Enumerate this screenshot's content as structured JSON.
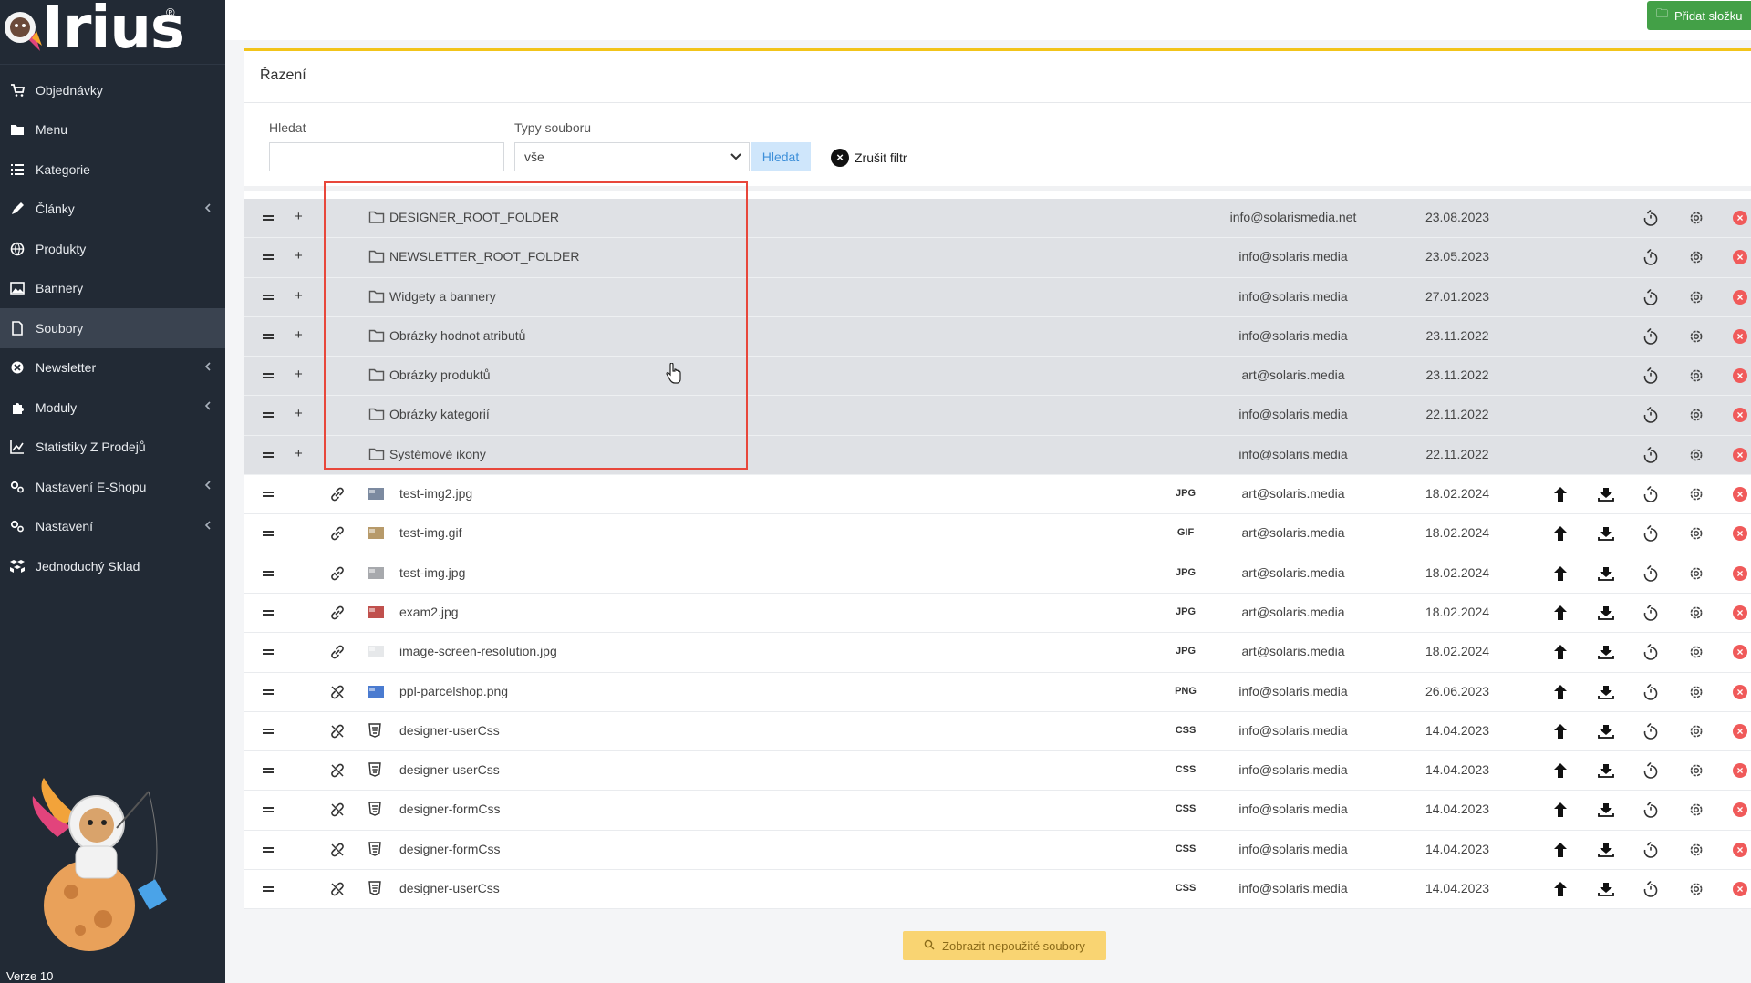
{
  "app": {
    "logo_text": "Irius",
    "logo_mark": "®",
    "version": "Verze 10"
  },
  "sidebar": {
    "items": [
      {
        "label": "Objednávky",
        "icon": "cart-icon",
        "chevron": false,
        "active": false
      },
      {
        "label": "Menu",
        "icon": "folder-icon",
        "chevron": false,
        "active": false
      },
      {
        "label": "Kategorie",
        "icon": "list-icon",
        "chevron": false,
        "active": false
      },
      {
        "label": "Články",
        "icon": "pen-icon",
        "chevron": true,
        "active": false
      },
      {
        "label": "Produkty",
        "icon": "globe-icon",
        "chevron": false,
        "active": false
      },
      {
        "label": "Bannery",
        "icon": "image-icon",
        "chevron": false,
        "active": false
      },
      {
        "label": "Soubory",
        "icon": "file-icon",
        "chevron": false,
        "active": true
      },
      {
        "label": "Newsletter",
        "icon": "newsletter-icon",
        "chevron": true,
        "active": false
      },
      {
        "label": "Moduly",
        "icon": "puzzle-icon",
        "chevron": true,
        "active": false
      },
      {
        "label": "Statistiky Z Prodejů",
        "icon": "chart-icon",
        "chevron": false,
        "active": false
      },
      {
        "label": "Nastavení E-Shopu",
        "icon": "cogs-icon",
        "chevron": true,
        "active": false
      },
      {
        "label": "Nastavení",
        "icon": "cogs-icon",
        "chevron": true,
        "active": false
      },
      {
        "label": "Jednoduchý Sklad",
        "icon": "boxes-icon",
        "chevron": false,
        "active": false
      }
    ]
  },
  "toolbar": {
    "add_folder_label": "Přidat složku"
  },
  "card": {
    "title": "Řazení",
    "search_label": "Hledat",
    "search_value": "",
    "type_label": "Typy souboru",
    "type_selected": "vše",
    "search_button": "Hledat",
    "clear_filter": "Zrušit filtr"
  },
  "folders": [
    {
      "name": "DESIGNER_ROOT_FOLDER",
      "owner": "info@solarismedia.net",
      "date": "23.08.2023"
    },
    {
      "name": "NEWSLETTER_ROOT_FOLDER",
      "owner": "info@solaris.media",
      "date": "23.05.2023"
    },
    {
      "name": "Widgety a bannery",
      "owner": "info@solaris.media",
      "date": "27.01.2023"
    },
    {
      "name": "Obrázky hodnot atributů",
      "owner": "info@solaris.media",
      "date": "23.11.2022"
    },
    {
      "name": "Obrázky produktů",
      "owner": "art@solaris.media",
      "date": "23.11.2022"
    },
    {
      "name": "Obrázky kategorií",
      "owner": "info@solaris.media",
      "date": "22.11.2022"
    },
    {
      "name": "Systémové ikony",
      "owner": "info@solaris.media",
      "date": "22.11.2022"
    }
  ],
  "files": [
    {
      "name": "test-img2.jpg",
      "type": "JPG",
      "owner": "art@solaris.media",
      "date": "18.02.2024",
      "linked": true,
      "thumb": "#7c8aa0"
    },
    {
      "name": "test-img.gif",
      "type": "GIF",
      "owner": "art@solaris.media",
      "date": "18.02.2024",
      "linked": true,
      "thumb": "#b79a6a"
    },
    {
      "name": "test-img.jpg",
      "type": "JPG",
      "owner": "art@solaris.media",
      "date": "18.02.2024",
      "linked": true,
      "thumb": "#a7a9ad"
    },
    {
      "name": "exam2.jpg",
      "type": "JPG",
      "owner": "art@solaris.media",
      "date": "18.02.2024",
      "linked": true,
      "thumb": "#c0504d"
    },
    {
      "name": "image-screen-resolution.jpg",
      "type": "JPG",
      "owner": "art@solaris.media",
      "date": "18.02.2024",
      "linked": true,
      "thumb": "#e6e8ea"
    },
    {
      "name": "ppl-parcelshop.png",
      "type": "PNG",
      "owner": "info@solaris.media",
      "date": "26.06.2023",
      "linked": false,
      "thumb": "#4a7bd0"
    },
    {
      "name": "designer-userCss",
      "type": "CSS",
      "owner": "info@solaris.media",
      "date": "14.04.2023",
      "linked": false,
      "thumb": "css"
    },
    {
      "name": "designer-userCss",
      "type": "CSS",
      "owner": "info@solaris.media",
      "date": "14.04.2023",
      "linked": false,
      "thumb": "css"
    },
    {
      "name": "designer-formCss",
      "type": "CSS",
      "owner": "info@solaris.media",
      "date": "14.04.2023",
      "linked": false,
      "thumb": "css"
    },
    {
      "name": "designer-formCss",
      "type": "CSS",
      "owner": "info@solaris.media",
      "date": "14.04.2023",
      "linked": false,
      "thumb": "css"
    },
    {
      "name": "designer-userCss",
      "type": "CSS",
      "owner": "info@solaris.media",
      "date": "14.04.2023",
      "linked": false,
      "thumb": "css"
    }
  ],
  "footer": {
    "unused_button": "Zobrazit nepoužité soubory"
  },
  "colors": {
    "sidebar_bg": "#222a35",
    "accent_yellow": "#f2c41a",
    "add_green": "#43a047",
    "delete_red": "#f05a5a",
    "highlight_red": "#e8473b"
  }
}
